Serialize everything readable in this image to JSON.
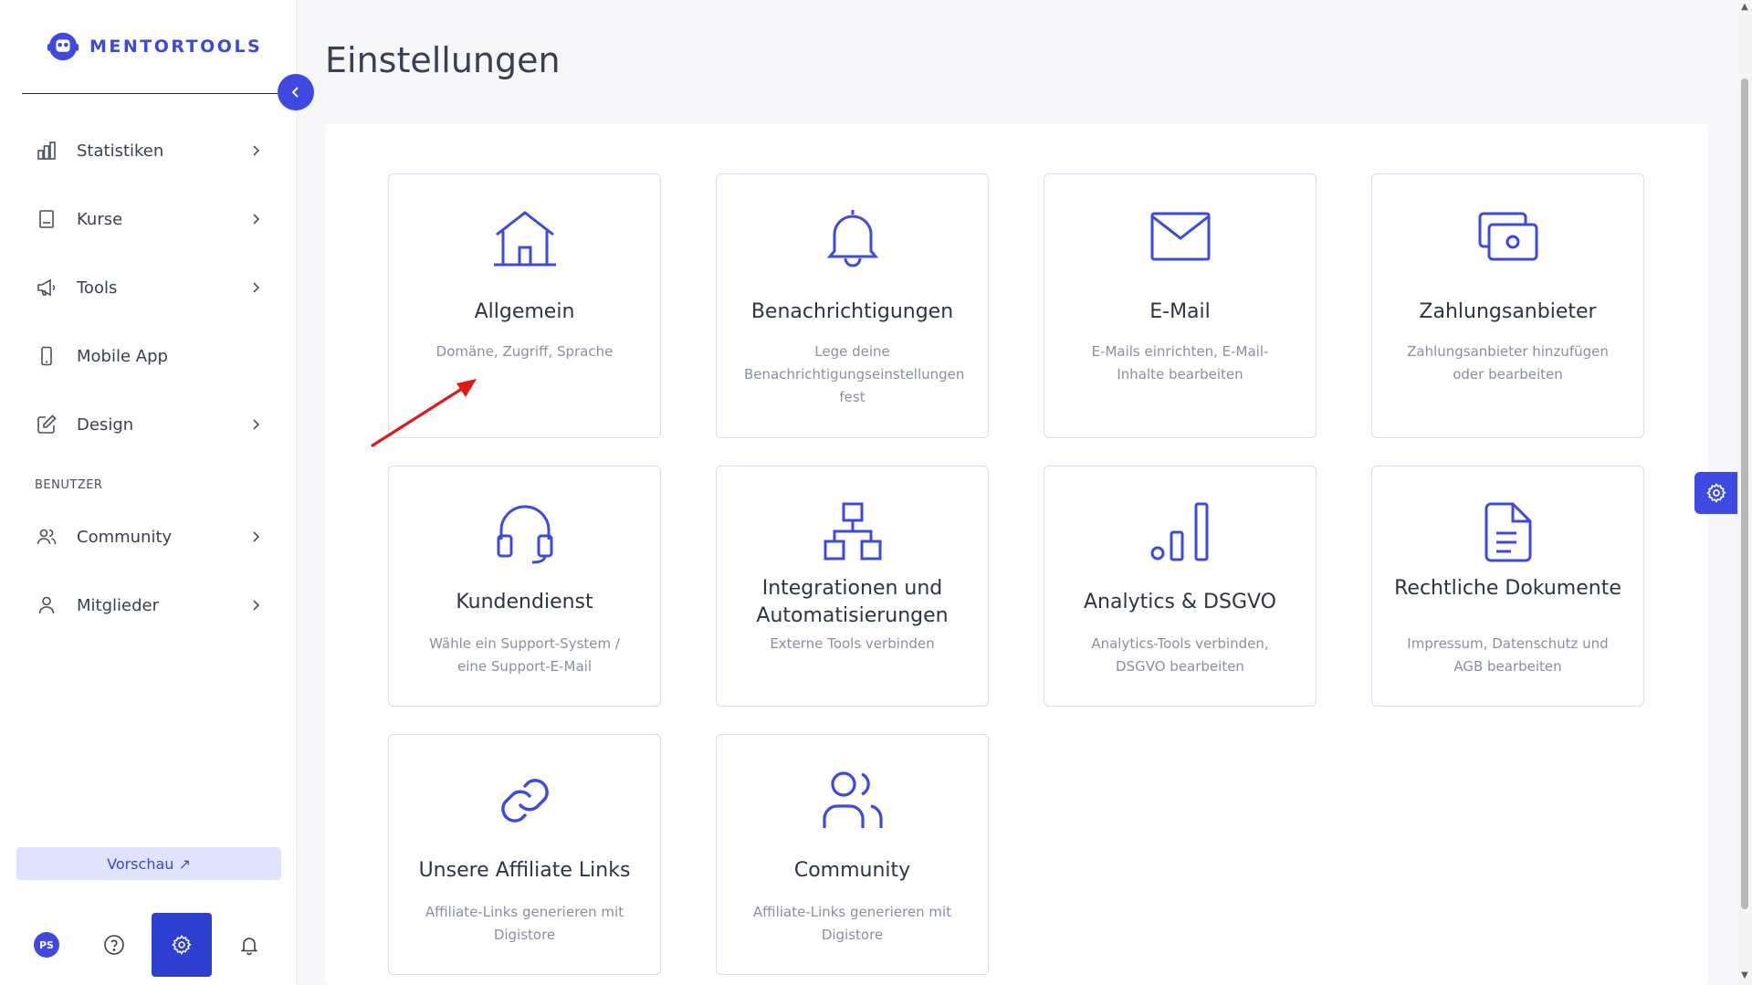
{
  "app": {
    "logo_text": "MENTORTOOLS",
    "brand_color": "#3d49e0"
  },
  "sidebar": {
    "items": [
      {
        "label": "Statistiken",
        "icon": "bar-chart-icon",
        "has_chevron": true
      },
      {
        "label": "Kurse",
        "icon": "book-icon",
        "has_chevron": true
      },
      {
        "label": "Tools",
        "icon": "megaphone-icon",
        "has_chevron": true
      },
      {
        "label": "Mobile App",
        "icon": "mobile-icon",
        "has_chevron": false
      },
      {
        "label": "Design",
        "icon": "pen-square-icon",
        "has_chevron": true
      }
    ],
    "section_label": "BENUTZER",
    "user_items": [
      {
        "label": "Community",
        "icon": "users-icon",
        "has_chevron": true
      },
      {
        "label": "Mitglieder",
        "icon": "user-icon",
        "has_chevron": true
      }
    ],
    "preview_label": "Vorschau ↗",
    "avatar_initials": "PS"
  },
  "page": {
    "title": "Einstellungen"
  },
  "cards": [
    {
      "title": "Allgemein",
      "desc": "Domäne, Zugriff, Sprache",
      "icon": "home-icon"
    },
    {
      "title": "Benachrichtigungen",
      "desc": "Lege deine Benachrichtigungseinstellungen fest",
      "icon": "bell-icon"
    },
    {
      "title": "E-Mail",
      "desc": "E-Mails einrichten, E-Mail-Inhalte bearbeiten",
      "icon": "mail-icon"
    },
    {
      "title": "Zahlungsanbieter",
      "desc": "Zahlungsanbieter hinzufügen oder bearbeiten",
      "icon": "payment-icon"
    },
    {
      "title": "Kundendienst",
      "desc": "Wähle ein Support-System / eine Support-E-Mail",
      "icon": "headset-icon"
    },
    {
      "title": "Integrationen und Automatisierungen",
      "desc": "Externe Tools verbinden",
      "icon": "network-icon"
    },
    {
      "title": "Analytics & DSGVO",
      "desc": "Analytics-Tools verbinden, DSGVO bearbeiten",
      "icon": "analytics-icon"
    },
    {
      "title": "Rechtliche Dokumente",
      "desc": "Impressum, Datenschutz und AGB bearbeiten",
      "icon": "document-icon"
    },
    {
      "title": "Unsere Affiliate Links",
      "desc": "Affiliate-Links generieren mit Digistore",
      "icon": "link-icon"
    },
    {
      "title": "Community",
      "desc": "Affiliate-Links generieren mit Digistore",
      "icon": "community-icon"
    }
  ]
}
